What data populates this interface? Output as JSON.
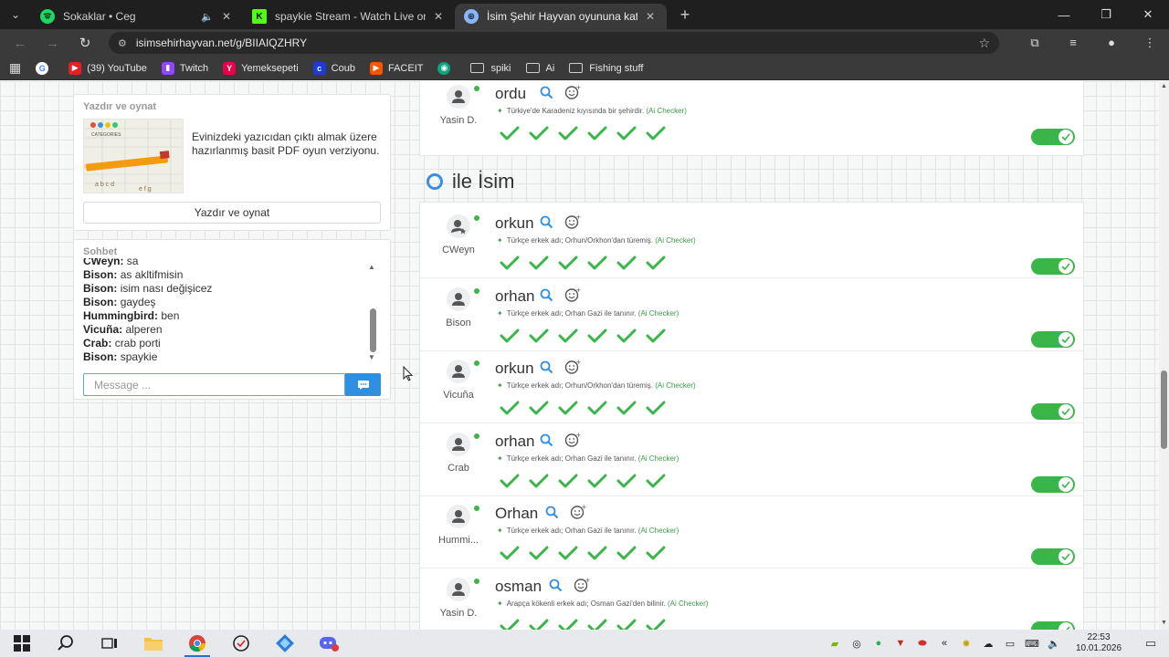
{
  "browser": {
    "tabs": [
      {
        "title": "Sokaklar • Ceg",
        "favicon": "spotify-icon",
        "active": false,
        "audio": true
      },
      {
        "title": "spaykie Stream - Watch Live on",
        "favicon": "kick-icon",
        "active": false,
        "audio": false
      },
      {
        "title": "İsim Şehir Hayvan oyununa katıl",
        "favicon": "game-icon",
        "active": true,
        "audio": false
      }
    ],
    "url": "isimsehirhayvan.net/g/BIIAIQZHRY",
    "bookmarks": [
      {
        "label": "",
        "icon": "google-icon"
      },
      {
        "label": "(39) YouTube",
        "icon": "youtube-icon"
      },
      {
        "label": "Twitch",
        "icon": "twitch-icon"
      },
      {
        "label": "Yemeksepeti",
        "icon": "yemeksepeti-icon"
      },
      {
        "label": "Coub",
        "icon": "coub-icon"
      },
      {
        "label": "FACEIT",
        "icon": "faceit-icon"
      },
      {
        "label": "",
        "icon": "app-icon"
      },
      {
        "label": "spiki",
        "icon": "folder-icon"
      },
      {
        "label": "Ai",
        "icon": "folder-icon"
      },
      {
        "label": "Fishing stuff",
        "icon": "folder-icon"
      }
    ]
  },
  "print_card": {
    "title": "Yazdır ve oynat",
    "description": "Evinizdeki yazıcıdan çıktı almak üzere hazırlanmış basit PDF oyun verziyonu.",
    "button": "Yazdır ve oynat"
  },
  "chat": {
    "title": "Sohbet",
    "messages": [
      {
        "user": "CWeyn:",
        "text": "sa"
      },
      {
        "user": "Bison:",
        "text": "as akltifmisin"
      },
      {
        "user": "Bison:",
        "text": "isim nası değişicez"
      },
      {
        "user": "Bison:",
        "text": "gaydeş"
      },
      {
        "user": "Hummingbird:",
        "text": "ben"
      },
      {
        "user": "Vicuña:",
        "text": "alperen"
      },
      {
        "user": "Crab:",
        "text": "crab porti"
      },
      {
        "user": "Bison:",
        "text": "spaykie"
      }
    ],
    "placeholder": "Message ..."
  },
  "top_answer": {
    "player": "Yasin D.",
    "word": "ordu",
    "checker_text": "Türkiye'de Karadeniz kıyısında bir şehirdir.",
    "checker_tag": "(Ai Checker)",
    "votes": 6,
    "accepted": true
  },
  "section": {
    "letter": "O",
    "title": "ile İsim"
  },
  "answers": [
    {
      "player": "CWeyn",
      "word": "orkun",
      "checker_text": "Türkçe erkek adı; Orhun/Orkhon'dan türemiş.",
      "checker_tag": "(Ai Checker)",
      "votes": 6,
      "accepted": true,
      "host": true
    },
    {
      "player": "Bison",
      "word": "orhan",
      "checker_text": "Türkçe erkek adı; Orhan Gazi ile tanınır.",
      "checker_tag": "(Ai Checker)",
      "votes": 6,
      "accepted": true,
      "host": false
    },
    {
      "player": "Vicuña",
      "word": "orkun",
      "checker_text": "Türkçe erkek adı; Orhun/Orkhon'dan türemiş.",
      "checker_tag": "(Ai Checker)",
      "votes": 6,
      "accepted": true,
      "host": false
    },
    {
      "player": "Crab",
      "word": "orhan",
      "checker_text": "Türkçe erkek adı; Orhan Gazi ile tanınır.",
      "checker_tag": "(Ai Checker)",
      "votes": 6,
      "accepted": true,
      "host": false
    },
    {
      "player": "Hummi...",
      "word": "Orhan",
      "checker_text": "Türkçe erkek adı; Orhan Gazi ile tanınır.",
      "checker_tag": "(Ai Checker)",
      "votes": 6,
      "accepted": true,
      "host": false
    },
    {
      "player": "Yasin D.",
      "word": "osman",
      "checker_text": "Arapça kökenli erkek adı; Osman Gazi'den bilinir.",
      "checker_tag": "(Ai Checker)",
      "votes": 6,
      "accepted": true,
      "host": false
    }
  ],
  "taskbar": {
    "time": "22:53",
    "date": "10.01.2026",
    "apps": [
      "windows-start-icon",
      "search-icon",
      "task-view-icon",
      "file-explorer-icon",
      "chrome-icon",
      "app-icon",
      "app-icon",
      "discord-icon"
    ]
  },
  "colors": {
    "accent_green": "#3ab54a",
    "accent_blue": "#2f8fe0",
    "chrome_dark": "#1f1f1f"
  }
}
